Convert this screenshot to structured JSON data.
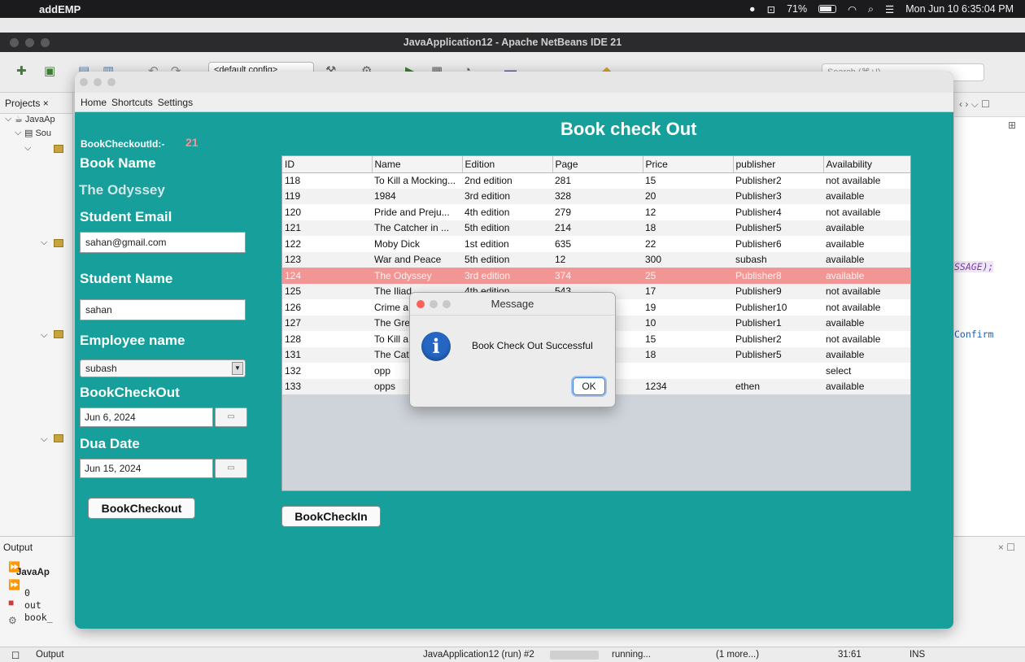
{
  "menubar": {
    "app_name": "addEMP",
    "battery": "71%",
    "clock": "Mon Jun 10  6:35:04 PM"
  },
  "netbeans": {
    "window_title": "JavaApplication12 - Apache NetBeans IDE 21",
    "config_select": "<default config>",
    "search_placeholder": "Search (⌘+I)",
    "projects_tab": "Projects",
    "project_root": "JavaAp",
    "source_node": "Sou",
    "code_snippet_1": "SSAGE);",
    "code_snippet_2": "Confirm",
    "output_tab": "Output",
    "output_lines": [
      "JavaAp",
      "0",
      "out",
      "book_"
    ],
    "status": {
      "output_label": "Output",
      "run_label": "JavaApplication12 (run) #2",
      "progress_label": "running...",
      "more": "(1 more...)",
      "position": "31:61",
      "mode": "INS"
    }
  },
  "app": {
    "menu": [
      "Home",
      "Shortcuts",
      "Settings"
    ],
    "page_title": "Book check Out",
    "form": {
      "checkout_id_label": "BookCheckoutId:-",
      "checkout_id_value": "21",
      "book_name_label": "Book Name",
      "book_name_value": "The Odyssey",
      "student_email_label": "Student Email",
      "student_email_value": "sahan@gmail.com",
      "student_name_label": "Student Name",
      "student_name_value": "sahan",
      "employee_name_label": "Employee name",
      "employee_name_value": "subash",
      "checkout_label": "BookCheckOut",
      "checkout_date": "Jun 6, 2024",
      "due_date_label": "Dua Date",
      "due_date": "Jun 15, 2024",
      "checkout_button": "BookCheckout"
    },
    "checkin_button": "BookCheckIn",
    "table": {
      "columns": [
        "ID",
        "Name",
        "Edition",
        "Page",
        "Price",
        "publisher",
        "Availability"
      ],
      "selected_index": 6,
      "rows": [
        [
          "118",
          "To Kill a Mocking...",
          "2nd edition",
          "281",
          "15",
          "Publisher2",
          "not available"
        ],
        [
          "119",
          "1984",
          "3rd edition",
          "328",
          "20",
          "Publisher3",
          "available"
        ],
        [
          "120",
          "Pride and Preju...",
          "4th edition",
          "279",
          "12",
          "Publisher4",
          "not available"
        ],
        [
          "121",
          "The Catcher in ...",
          "5th edition",
          "214",
          "18",
          "Publisher5",
          "available"
        ],
        [
          "122",
          "Moby Dick",
          "1st edition",
          "635",
          "22",
          "Publisher6",
          "available"
        ],
        [
          "123",
          "War and Peace",
          "5th edition",
          "12",
          "300",
          "subash",
          "available"
        ],
        [
          "124",
          "The Odyssey",
          "3rd edition",
          "374",
          "25",
          "Publisher8",
          "available"
        ],
        [
          "125",
          "The Iliad",
          "4th edition",
          "543",
          "17",
          "Publisher9",
          "not available"
        ],
        [
          "126",
          "Crime a",
          "",
          "",
          "19",
          "Publisher10",
          "not available"
        ],
        [
          "127",
          "The Gre",
          "",
          "",
          "10",
          "Publisher1",
          "available"
        ],
        [
          "128",
          "To Kill a",
          "",
          "",
          "15",
          "Publisher2",
          "not available"
        ],
        [
          "131",
          "The Cat",
          "",
          "",
          "18",
          "Publisher5",
          "available"
        ],
        [
          "132",
          "opp",
          "",
          "",
          "",
          "",
          "select"
        ],
        [
          "133",
          "opps",
          "",
          "",
          "1234",
          "ethen",
          "available"
        ]
      ]
    },
    "dialog": {
      "title": "Message",
      "message": "Book Check Out Successful",
      "ok_label": "OK"
    }
  }
}
